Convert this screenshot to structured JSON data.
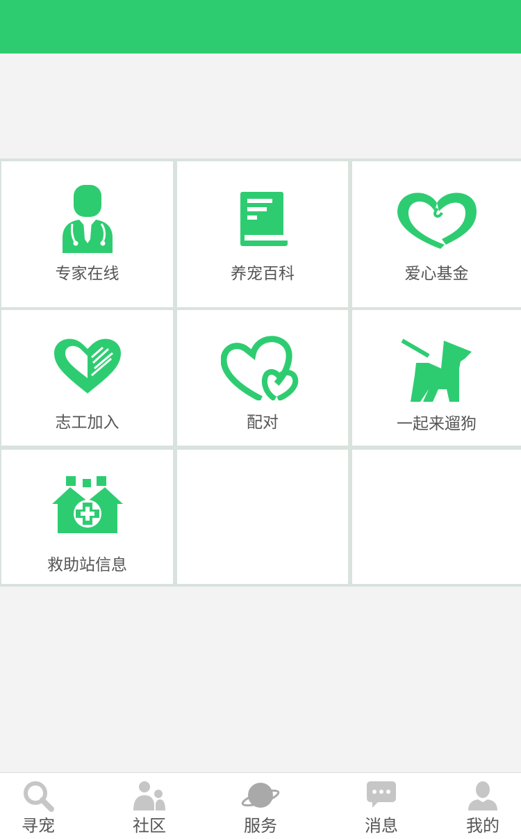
{
  "colors": {
    "accent": "#2ecc71",
    "tab_icon": "#c6c6c6",
    "text": "#555555"
  },
  "services": [
    {
      "label": "专家在线",
      "icon": "doctor-icon"
    },
    {
      "label": "养宠百科",
      "icon": "book-icon"
    },
    {
      "label": "爱心基金",
      "icon": "heart-icon"
    },
    {
      "label": "志工加入",
      "icon": "heart-hand-icon"
    },
    {
      "label": "配对",
      "icon": "double-heart-icon"
    },
    {
      "label": "一起来遛狗",
      "icon": "dog-walk-icon"
    },
    {
      "label": "救助站信息",
      "icon": "rescue-station-icon"
    }
  ],
  "tabbar": {
    "items": [
      {
        "label": "寻宠",
        "icon": "search-icon"
      },
      {
        "label": "社区",
        "icon": "people-icon"
      },
      {
        "label": "服务",
        "icon": "planet-icon"
      },
      {
        "label": "消息",
        "icon": "chat-bubble-icon"
      },
      {
        "label": "我的",
        "icon": "user-icon"
      }
    ]
  }
}
